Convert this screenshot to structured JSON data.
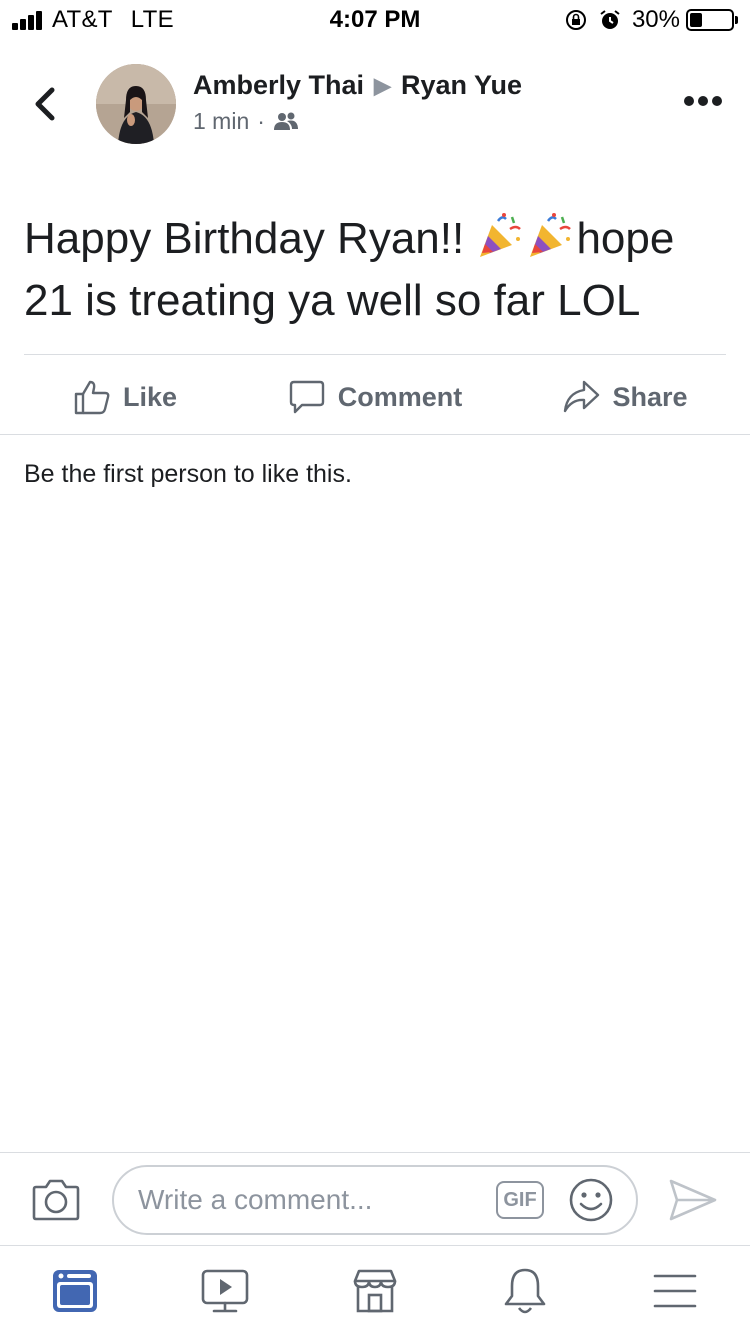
{
  "status_bar": {
    "carrier": "AT&T",
    "network": "LTE",
    "time": "4:07 PM",
    "battery_percent": "30%",
    "battery_level": 0.3
  },
  "post": {
    "author": "Amberly Thai",
    "recipient": "Ryan Yue",
    "time_ago": "1 min",
    "audience_icon": "friends-icon",
    "text_part1": "Happy Birthday Ryan!!",
    "text_part2": "hope 21 is treating ya well so far LOL",
    "emojis": [
      "party-popper-icon",
      "party-popper-icon"
    ]
  },
  "actions": {
    "like": "Like",
    "comment": "Comment",
    "share": "Share"
  },
  "likes_summary": "Be the first person to like this.",
  "composer": {
    "placeholder": "Write a comment...",
    "gif_label": "GIF"
  },
  "tabs": [
    {
      "icon": "news-feed-icon",
      "active": true
    },
    {
      "icon": "watch-icon",
      "active": false
    },
    {
      "icon": "marketplace-icon",
      "active": false
    },
    {
      "icon": "notifications-icon",
      "active": false
    },
    {
      "icon": "menu-icon",
      "active": false
    }
  ],
  "colors": {
    "active_tab": "#4267b2",
    "icon_gray": "#606770",
    "text": "#1c1e21"
  }
}
